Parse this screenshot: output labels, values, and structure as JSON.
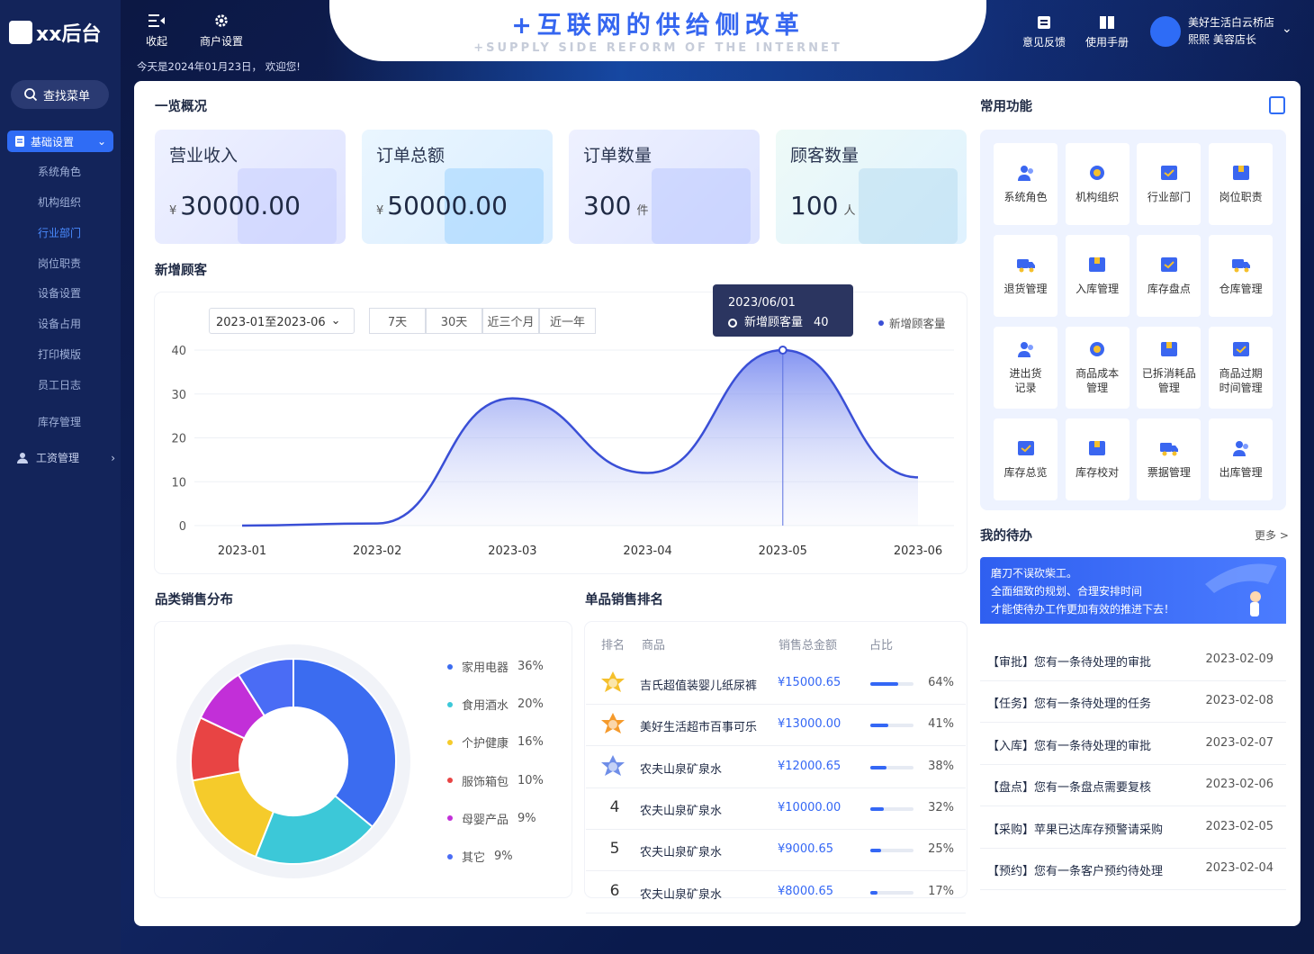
{
  "app": {
    "logo": "xx后台",
    "search_menu": "查找菜单"
  },
  "sidebar": {
    "group1": "基础设置",
    "items": [
      "系统角色",
      "机构组织",
      "行业部门",
      "岗位职责",
      "设备设置",
      "设备占用",
      "打印模版",
      "员工日志",
      "库存管理"
    ],
    "active_item": "行业部门",
    "group2": "工资管理"
  },
  "toolbar": {
    "collapse": "收起",
    "merchant_settings": "商户设置",
    "welcome": "今天是2024年01月23日， 欢迎您!"
  },
  "banner": {
    "title": "+互联网的供给侧改革",
    "subtitle": "+SUPPLY SIDE REFORM OF THE INTERNET"
  },
  "topright": {
    "feedback": "意见反馈",
    "manual": "使用手册",
    "store": "美好生活白云桥店",
    "user": "熙熙  美容店长"
  },
  "overview": {
    "title": "一览概况",
    "cards": [
      {
        "title": "营业收入",
        "prefix": "¥",
        "value": "30000.00",
        "unit": ""
      },
      {
        "title": "订单总额",
        "prefix": "¥",
        "value": "50000.00",
        "unit": ""
      },
      {
        "title": "订单数量",
        "prefix": "",
        "value": "300",
        "unit": "件"
      },
      {
        "title": "顾客数量",
        "prefix": "",
        "value": "100",
        "unit": "人"
      }
    ]
  },
  "customers": {
    "title": "新增顾客",
    "date_range": "2023-01至2023-06",
    "ranges": [
      "7天",
      "30天",
      "近三个月",
      "近一年"
    ],
    "tooltip": {
      "date": "2023/06/01",
      "label": "新增顾客量",
      "value": "40"
    }
  },
  "chart_data": {
    "type": "area",
    "x": [
      "2023-01",
      "2023-02",
      "2023-03",
      "2023-04",
      "2023-05",
      "2023-06"
    ],
    "series": [
      {
        "name": "新增顾客量",
        "values": [
          0,
          0.5,
          29,
          12,
          40,
          11
        ]
      }
    ],
    "yticks": [
      40,
      30,
      20,
      10,
      0
    ],
    "ylim": [
      0,
      40
    ],
    "legend": "top-right",
    "color": "#3a4fd6"
  },
  "category": {
    "title": "品类销售分布",
    "items": [
      {
        "name": "家用电器",
        "pct": "36%",
        "value": 36,
        "color": "#3b6cf0"
      },
      {
        "name": "食用酒水",
        "pct": "20%",
        "value": 20,
        "color": "#3cc8d8"
      },
      {
        "name": "个护健康",
        "pct": "16%",
        "value": 16,
        "color": "#f5cb2b"
      },
      {
        "name": "服饰箱包",
        "pct": "10%",
        "value": 10,
        "color": "#e84444"
      },
      {
        "name": "母婴产品",
        "pct": "9%",
        "value": 9,
        "color": "#c22fd8"
      },
      {
        "name": "其它",
        "pct": "9%",
        "value": 9,
        "color": "#4a6cf5"
      }
    ]
  },
  "ranking": {
    "title": "单品销售排名",
    "headers": [
      "排名",
      "商品",
      "销售总金额",
      "占比"
    ],
    "rows": [
      {
        "rank": "1",
        "name": "吉氏超值装婴儿纸尿裤",
        "amount": "¥15000.65",
        "pct": "64%",
        "value": 0.64
      },
      {
        "rank": "2",
        "name": "美好生活超市百事可乐",
        "amount": "¥13000.00",
        "pct": "41%",
        "value": 0.41
      },
      {
        "rank": "3",
        "name": "农夫山泉矿泉水",
        "amount": "¥12000.65",
        "pct": "38%",
        "value": 0.38
      },
      {
        "rank": "4",
        "name": "农夫山泉矿泉水",
        "amount": "¥10000.00",
        "pct": "32%",
        "value": 0.32
      },
      {
        "rank": "5",
        "name": "农夫山泉矿泉水",
        "amount": "¥9000.65",
        "pct": "25%",
        "value": 0.25
      },
      {
        "rank": "6",
        "name": "农夫山泉矿泉水",
        "amount": "¥8000.65",
        "pct": "17%",
        "value": 0.17
      }
    ]
  },
  "functions": {
    "title": "常用功能",
    "items": [
      {
        "label": "系统角色",
        "icon": "users-icon"
      },
      {
        "label": "机构组织",
        "icon": "yuan-icon"
      },
      {
        "label": "行业部门",
        "icon": "checkbox-icon"
      },
      {
        "label": "岗位职责",
        "icon": "box-icon"
      },
      {
        "label": "退货管理",
        "icon": "truck-icon"
      },
      {
        "label": "入库管理",
        "icon": "box-icon"
      },
      {
        "label": "库存盘点",
        "icon": "checkbox-icon"
      },
      {
        "label": "仓库管理",
        "icon": "truck-icon"
      },
      {
        "label": "进出货\n记录",
        "icon": "users-icon"
      },
      {
        "label": "商品成本\n管理",
        "icon": "yuan-icon"
      },
      {
        "label": "已拆消耗品\n管理",
        "icon": "box-icon"
      },
      {
        "label": "商品过期\n时间管理",
        "icon": "checkbox-icon"
      },
      {
        "label": "库存总览",
        "icon": "checkbox-icon"
      },
      {
        "label": "库存校对",
        "icon": "box-icon"
      },
      {
        "label": "票据管理",
        "icon": "truck-icon"
      },
      {
        "label": "出库管理",
        "icon": "users-icon"
      }
    ]
  },
  "todo": {
    "title": "我的待办",
    "more": "更多 >",
    "banner": [
      "磨刀不误砍柴工。",
      "全面细致的规划、合理安排时间",
      "才能使待办工作更加有效的推进下去！"
    ],
    "items": [
      {
        "text": "【审批】您有一条待处理的审批",
        "date": "2023-02-09"
      },
      {
        "text": "【任务】您有一条待处理的任务",
        "date": "2023-02-08"
      },
      {
        "text": "【入库】您有一条待处理的审批",
        "date": "2023-02-07"
      },
      {
        "text": "【盘点】您有一条盘点需要复核",
        "date": "2023-02-06"
      },
      {
        "text": "【采购】苹果已达库存预警请采购",
        "date": "2023-02-05"
      },
      {
        "text": "【预约】您有一条客户预约待处理",
        "date": "2023-02-04"
      }
    ]
  }
}
